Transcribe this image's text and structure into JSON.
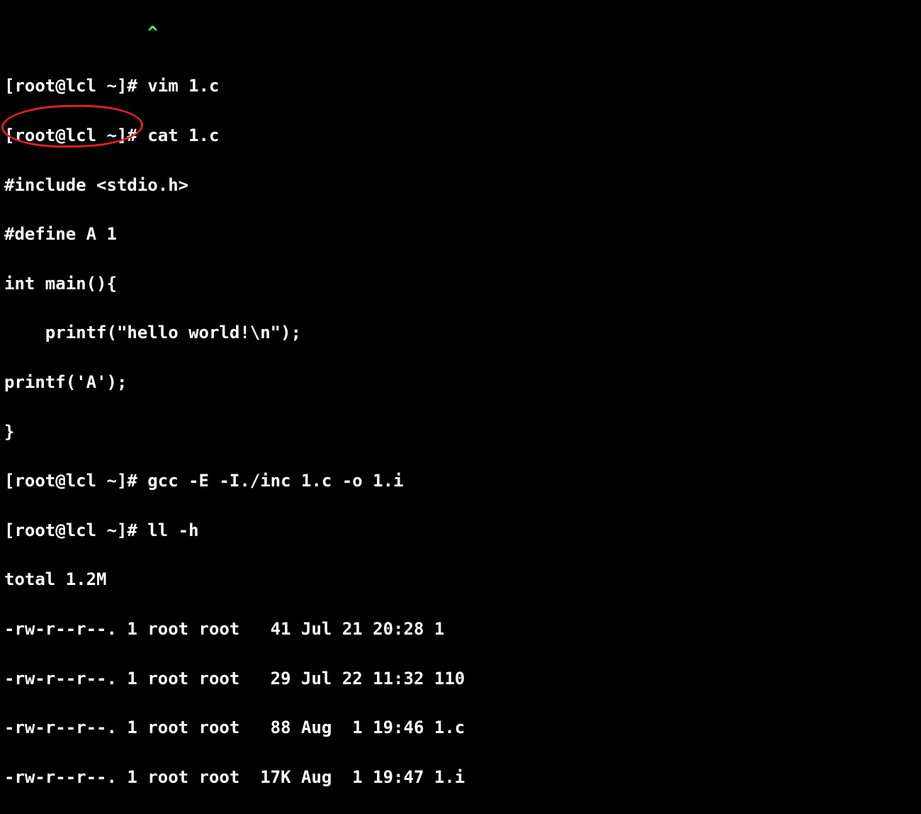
{
  "cursor_mark": "^",
  "lines": {
    "l1": "[root@lcl ~]# vim 1.c",
    "l2": "[root@lcl ~]# cat 1.c",
    "l3": "#include <stdio.h>",
    "l4": "#define A 1",
    "l5": "int main(){",
    "l6": "    printf(\"hello world!\\n\");",
    "l7": "printf('A');",
    "l8": "}",
    "l9": "[root@lcl ~]# gcc -E -I./inc 1.c -o 1.i",
    "l10": "[root@lcl ~]# ll -h",
    "l11": "total 1.2M",
    "l12": "-rw-r--r--. 1 root root   41 Jul 21 20:28 1",
    "l13": "-rw-r--r--. 1 root root   29 Jul 22 11:32 110",
    "l14": "-rw-r--r--. 1 root root   88 Aug  1 19:46 1.c",
    "l15": "-rw-r--r--. 1 root root  17K Aug  1 19:47 1.i"
  },
  "annotation": {
    "color": "#e02020"
  }
}
